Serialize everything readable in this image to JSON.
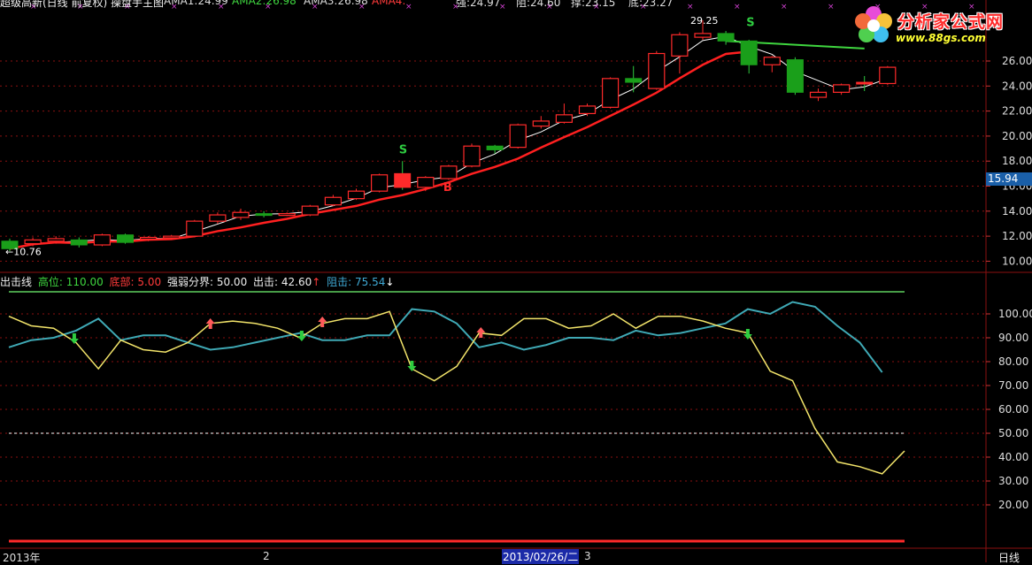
{
  "header": {
    "title_fragment": "超级高新(日线 前复权) 操盘手主图",
    "ama1_label": "AMA1:",
    "ama1_value": "24.99",
    "ama2_label": "AMA2:",
    "ama2_value": "26.98",
    "ama3_label": "AMA3:",
    "ama3_value": "26.98",
    "ama4_label": "AMA4:",
    "strong_label": "强:",
    "strong_value": "24.97",
    "resist_label": "阻:",
    "resist_value": "24.60",
    "support_label": "撑:",
    "support_value": "23.15",
    "bottom_label": "底:",
    "bottom_value": "23.27"
  },
  "logo": {
    "title": "分析家公式网",
    "url": "www.88gs.com"
  },
  "price_axis": {
    "ticks": [
      "26.00",
      "24.00",
      "22.00",
      "20.00",
      "18.00",
      "16.00",
      "14.00",
      "12.00",
      "10.00"
    ],
    "tick_values": [
      26,
      24,
      22,
      20,
      18,
      16,
      14,
      12,
      10
    ],
    "current_price": "15.94",
    "high_marker": "29.25",
    "low_marker": "←10.76",
    "signals": [
      {
        "text": "S",
        "color": "#2ecc40"
      },
      {
        "text": "S",
        "color": "#2ecc40"
      },
      {
        "text": "B",
        "color": "#ff2a2a"
      }
    ]
  },
  "indicator": {
    "name": "出击线",
    "high_label": "高位:",
    "high_value": "110.00",
    "bottom_label": "底部:",
    "bottom_value": "5.00",
    "divide_label": "强弱分界:",
    "divide_value": "50.00",
    "attack_label": "出击:",
    "attack_value": "42.60",
    "attack_arrow": "↑",
    "resist_label": "阻击:",
    "resist_value": "75.54",
    "resist_arrow": "↓",
    "axis_ticks": [
      "100.00",
      "90.00",
      "80.00",
      "70.00",
      "60.00",
      "50.00",
      "40.00",
      "30.00",
      "20.00"
    ],
    "axis_values": [
      100,
      90,
      80,
      70,
      60,
      50,
      40,
      30,
      20
    ],
    "high_level": 110,
    "divide_level": 50,
    "bottom_level": 5,
    "attack_series": [
      99,
      95,
      94,
      88,
      77,
      89,
      85,
      84,
      88,
      96,
      97,
      96,
      94,
      90,
      96,
      98,
      98,
      101,
      77,
      72,
      78,
      92,
      91,
      98,
      98,
      94,
      95,
      100,
      94,
      99,
      99,
      97,
      94,
      92,
      76,
      72,
      52,
      38,
      36,
      33,
      42.6
    ],
    "resist_series": [
      86,
      89,
      90,
      93,
      98,
      89,
      91,
      91,
      88,
      85,
      86,
      88,
      90,
      92,
      89,
      89,
      91,
      91,
      102,
      101,
      96,
      86,
      88,
      85,
      87,
      90,
      90,
      89,
      93,
      91,
      92,
      94,
      96,
      102,
      100,
      105,
      103,
      95,
      88,
      75.54
    ]
  },
  "time_axis": {
    "year": "2013年",
    "month_2": "2",
    "date_highlight": "2013/02/26/二",
    "month_3": "3",
    "period": "日线"
  },
  "colors": {
    "background": "#000000",
    "up": "#ff2a2a",
    "down": "#1a9f1a",
    "attack_line": "#f2e46a",
    "resist_line": "#3fa9b5",
    "grid": "#8b1010"
  },
  "candles": [
    {
      "o": 11.6,
      "c": 11.0,
      "h": 11.8,
      "l": 10.8
    },
    {
      "o": 11.4,
      "c": 11.7,
      "h": 11.9,
      "l": 11.2
    },
    {
      "o": 11.6,
      "c": 11.8,
      "h": 12.0,
      "l": 11.4
    },
    {
      "o": 11.7,
      "c": 11.3,
      "h": 11.9,
      "l": 11.1
    },
    {
      "o": 11.3,
      "c": 12.1,
      "h": 12.2,
      "l": 11.2
    },
    {
      "o": 12.1,
      "c": 11.5,
      "h": 12.2,
      "l": 11.4
    },
    {
      "o": 11.8,
      "c": 11.9,
      "h": 12.0,
      "l": 11.6
    },
    {
      "o": 11.9,
      "c": 12.0,
      "h": 12.1,
      "l": 11.7
    },
    {
      "o": 12.0,
      "c": 13.2,
      "h": 13.3,
      "l": 11.9
    },
    {
      "o": 13.2,
      "c": 13.7,
      "h": 13.9,
      "l": 13.0
    },
    {
      "o": 13.5,
      "c": 13.9,
      "h": 14.2,
      "l": 13.3
    },
    {
      "o": 13.8,
      "c": 13.7,
      "h": 14.0,
      "l": 13.5
    },
    {
      "o": 13.7,
      "c": 13.8,
      "h": 13.9,
      "l": 13.6
    },
    {
      "o": 13.7,
      "c": 14.4,
      "h": 14.5,
      "l": 13.6
    },
    {
      "o": 14.5,
      "c": 15.1,
      "h": 15.3,
      "l": 14.4
    },
    {
      "o": 15.0,
      "c": 15.6,
      "h": 15.8,
      "l": 14.9
    },
    {
      "o": 15.6,
      "c": 16.9,
      "h": 17.0,
      "l": 15.5
    },
    {
      "o": 17.0,
      "c": 15.9,
      "h": 18.0,
      "l": 15.7
    },
    {
      "o": 15.9,
      "c": 16.7,
      "h": 16.8,
      "l": 15.6
    },
    {
      "o": 16.6,
      "c": 17.6,
      "h": 17.7,
      "l": 16.5
    },
    {
      "o": 17.6,
      "c": 19.2,
      "h": 19.4,
      "l": 17.5
    },
    {
      "o": 19.2,
      "c": 18.9,
      "h": 19.3,
      "l": 18.6
    },
    {
      "o": 19.1,
      "c": 20.9,
      "h": 21.0,
      "l": 19.0
    },
    {
      "o": 20.8,
      "c": 21.2,
      "h": 21.6,
      "l": 20.6
    },
    {
      "o": 21.1,
      "c": 21.7,
      "h": 22.6,
      "l": 21.0
    },
    {
      "o": 21.8,
      "c": 22.4,
      "h": 22.6,
      "l": 21.6
    },
    {
      "o": 22.3,
      "c": 24.6,
      "h": 24.7,
      "l": 22.2
    },
    {
      "o": 24.6,
      "c": 24.3,
      "h": 25.6,
      "l": 23.5
    },
    {
      "o": 23.8,
      "c": 26.6,
      "h": 26.8,
      "l": 23.7
    },
    {
      "o": 26.4,
      "c": 28.1,
      "h": 28.3,
      "l": 25.0
    },
    {
      "o": 27.9,
      "c": 28.2,
      "h": 29.25,
      "l": 27.7
    },
    {
      "o": 28.2,
      "c": 27.6,
      "h": 28.4,
      "l": 27.3
    },
    {
      "o": 27.6,
      "c": 25.7,
      "h": 27.7,
      "l": 25.0
    },
    {
      "o": 25.7,
      "c": 26.3,
      "h": 26.4,
      "l": 25.1
    },
    {
      "o": 26.1,
      "c": 23.5,
      "h": 26.3,
      "l": 23.3
    },
    {
      "o": 23.1,
      "c": 23.5,
      "h": 23.8,
      "l": 22.8
    },
    {
      "o": 23.5,
      "c": 24.1,
      "h": 24.2,
      "l": 23.3
    },
    {
      "o": 24.3,
      "c": 24.2,
      "h": 24.8,
      "l": 23.6
    },
    {
      "o": 24.2,
      "c": 25.5,
      "h": 25.6,
      "l": 24.1
    }
  ]
}
